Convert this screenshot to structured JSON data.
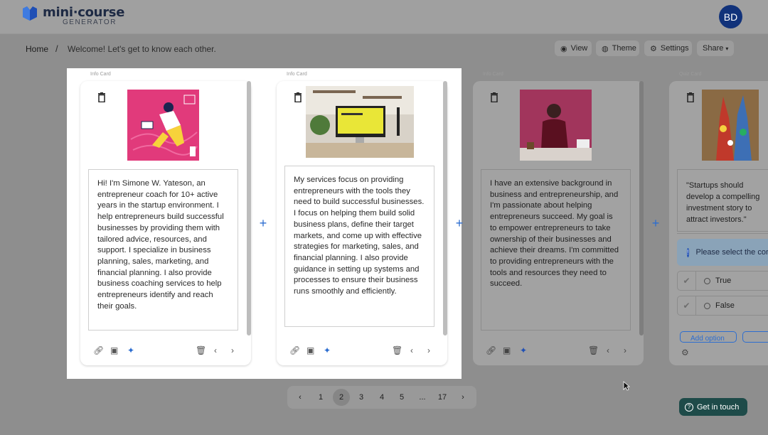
{
  "app": {
    "logo_main": "mini·course",
    "logo_sub": "GENERATOR",
    "avatar_initials": "BD"
  },
  "breadcrumb": {
    "home": "Home",
    "separator": "/",
    "current": "Welcome! Let's get to know each other."
  },
  "toolbar": {
    "view": "View",
    "theme": "Theme",
    "settings": "Settings",
    "share": "Share"
  },
  "cards": [
    {
      "type_label": "Info Card",
      "text": "Hi! I'm Simone W. Yateson, an entrepreneur coach for 10+ active years in the startup environment. I help entrepreneurs build successful businesses by providing them with tailored advice, resources, and support. I specialize in business planning, sales, marketing, and financial planning. I also provide business coaching services to help entrepreneurs identify and reach their goals."
    },
    {
      "type_label": "Info Card",
      "text": "My services focus on providing entrepreneurs with the tools they need to build successful businesses. I focus on helping them build solid business plans, define their target markets, and come up with effective strategies for marketing, sales, and financial planning. I also provide guidance in setting up systems and processes to ensure their business runs smoothly and efficiently."
    },
    {
      "type_label": "Info Card",
      "text": "I have an extensive background in business and entrepreneurship, and I'm passionate about helping entrepreneurs succeed. My goal is to empower entrepreneurs to take ownership of their businesses and achieve their dreams. I'm committed to providing entrepreneurs with the tools and resources they need to succeed."
    },
    {
      "type_label": "Quiz Card",
      "question": "\"Startups should develop a compelling investment story to attract investors.\"",
      "alert": "Please select the correct answer",
      "options": [
        "True",
        "False"
      ],
      "add_option": "Add option"
    }
  ],
  "pagination": {
    "prev": "‹",
    "pages": [
      "1",
      "2",
      "3",
      "4",
      "5",
      "...",
      "17"
    ],
    "next": "›",
    "current": "2"
  },
  "contact": {
    "label": "Get in touch"
  },
  "colors": {
    "accent": "#2c6dd0",
    "avatar": "#11327a",
    "contact_button": "#1e4b49"
  }
}
